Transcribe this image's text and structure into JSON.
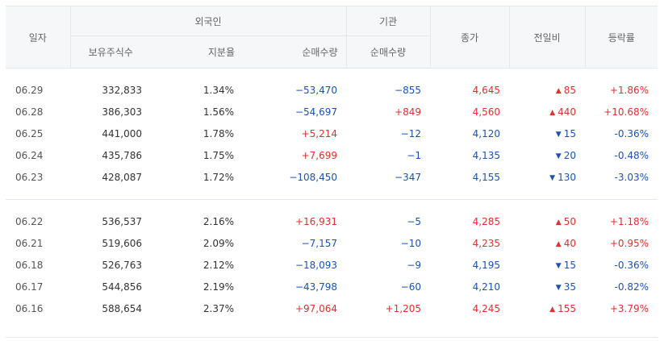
{
  "headers": {
    "date": "일자",
    "foreign": "외국인",
    "institution": "기관",
    "close": "종가",
    "change": "전일비",
    "rate": "등락률",
    "holdings": "보유주식수",
    "share_ratio": "지분율",
    "foreign_net": "순매수량",
    "inst_net": "순매수량"
  },
  "colors": {
    "up": "#e22f2f",
    "down": "#1b52b8",
    "header_bg": "#f6f7f9"
  },
  "groups": [
    [
      {
        "date": "06.29",
        "holdings": "332,833",
        "ratio": "1.34%",
        "foreign_net": "−53,470",
        "inst_net": "−855",
        "close": "4,645",
        "change": "85",
        "rate": "+1.86%",
        "dir": "up"
      },
      {
        "date": "06.28",
        "holdings": "386,303",
        "ratio": "1.56%",
        "foreign_net": "−54,697",
        "inst_net": "+849",
        "close": "4,560",
        "change": "440",
        "rate": "+10.68%",
        "dir": "up"
      },
      {
        "date": "06.25",
        "holdings": "441,000",
        "ratio": "1.78%",
        "foreign_net": "+5,214",
        "inst_net": "−12",
        "close": "4,120",
        "change": "15",
        "rate": "-0.36%",
        "dir": "down"
      },
      {
        "date": "06.24",
        "holdings": "435,786",
        "ratio": "1.75%",
        "foreign_net": "+7,699",
        "inst_net": "−1",
        "close": "4,135",
        "change": "20",
        "rate": "-0.48%",
        "dir": "down"
      },
      {
        "date": "06.23",
        "holdings": "428,087",
        "ratio": "1.72%",
        "foreign_net": "−108,450",
        "inst_net": "−347",
        "close": "4,155",
        "change": "130",
        "rate": "-3.03%",
        "dir": "down"
      }
    ],
    [
      {
        "date": "06.22",
        "holdings": "536,537",
        "ratio": "2.16%",
        "foreign_net": "+16,931",
        "inst_net": "−5",
        "close": "4,285",
        "change": "50",
        "rate": "+1.18%",
        "dir": "up"
      },
      {
        "date": "06.21",
        "holdings": "519,606",
        "ratio": "2.09%",
        "foreign_net": "−7,157",
        "inst_net": "−10",
        "close": "4,235",
        "change": "40",
        "rate": "+0.95%",
        "dir": "up"
      },
      {
        "date": "06.18",
        "holdings": "526,763",
        "ratio": "2.12%",
        "foreign_net": "−18,093",
        "inst_net": "−9",
        "close": "4,195",
        "change": "15",
        "rate": "-0.36%",
        "dir": "down"
      },
      {
        "date": "06.17",
        "holdings": "544,856",
        "ratio": "2.19%",
        "foreign_net": "−43,798",
        "inst_net": "−60",
        "close": "4,210",
        "change": "35",
        "rate": "-0.82%",
        "dir": "down"
      },
      {
        "date": "06.16",
        "holdings": "588,654",
        "ratio": "2.37%",
        "foreign_net": "+97,064",
        "inst_net": "+1,205",
        "close": "4,245",
        "change": "155",
        "rate": "+3.79%",
        "dir": "up"
      }
    ]
  ]
}
